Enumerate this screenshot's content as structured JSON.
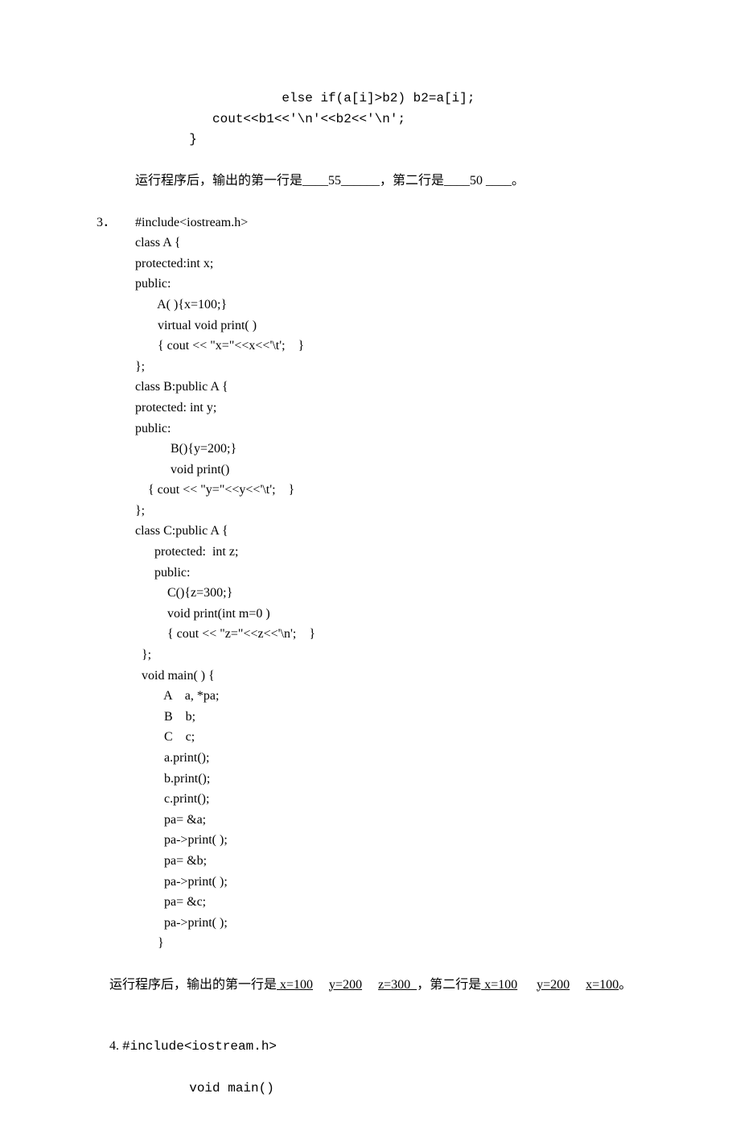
{
  "pre": {
    "l1": "                   else if(a[i]>b2) b2=a[i];",
    "l2": "          cout<<b1<<'\\n'<<b2<<'\\n';",
    "l3": "       }"
  },
  "q2": {
    "prefix": "        运行程序后，输出的第一行是____",
    "ans1": "55",
    "mid": "______，第二行是____",
    "ans2": "50",
    "suffix": " ____。"
  },
  "q3": {
    "num": "3．",
    "line0": "#include<iostream.h>",
    "code": [
      "class A {",
      "protected:int x;",
      "public:",
      "       A( ){x=100;}",
      "       virtual void print( )",
      "       { cout << \"x=\"<<x<<'\\t';    }",
      "};",
      "class B:public A {",
      "protected: int y;",
      "public:",
      "           B(){y=200;}",
      "           void print()",
      "    { cout << \"y=\"<<y<<'\\t';    }",
      "};",
      "class C:public A {",
      "      protected:  int z;",
      "      public:",
      "          C(){z=300;}",
      "          void print(int m=0 )",
      "          { cout << \"z=\"<<z<<'\\n';    }",
      "  };",
      "  void main( ) {",
      "         A    a, *pa;",
      "         B    b;",
      "         C    c;",
      "         a.print();",
      "         b.print();",
      "         c.print();",
      "         pa= &a;",
      "         pa->print( );",
      "         pa= &b;",
      "         pa->print( );",
      "         pa= &c;",
      "         pa->print( );",
      "       }"
    ],
    "result": {
      "prefix": "运行程序后，输出的第一行是",
      "ans1": " x=100",
      "ans2": "y=200",
      "ans3": "z=300  ",
      "mid": "，第二行是",
      "ans4": " x=100",
      "ans5": "y=200",
      "ans6": "x=100",
      "suffix": "。"
    }
  },
  "q4": {
    "num": "4. ",
    "l1": "#include<iostream.h>",
    "l2": "       void main()"
  }
}
